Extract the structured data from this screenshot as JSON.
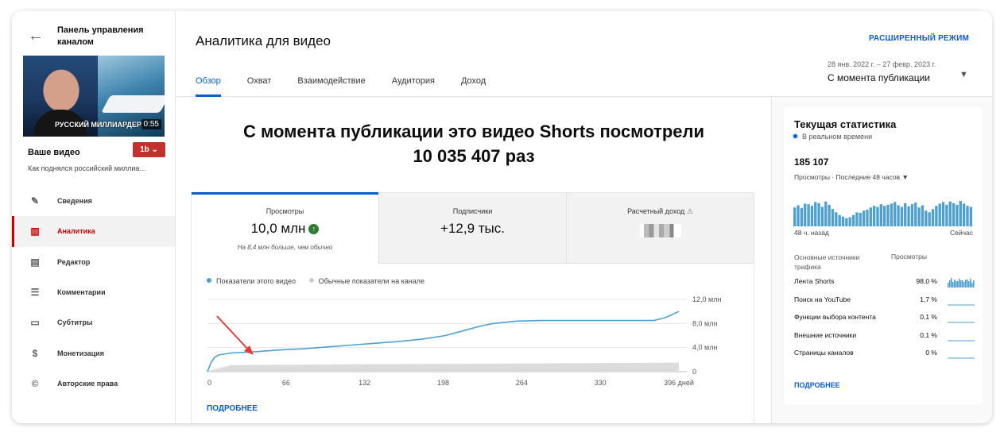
{
  "sidebar": {
    "title": "Панель управления каналом",
    "thumbnail_overlay": "РУССКИЙ МИЛЛИАРДЕР",
    "duration": "0:55",
    "your_video": "Ваше видео",
    "video_title": "Как поднялся российский миллиа…",
    "items": [
      {
        "label": "Сведения",
        "icon": "pencil-icon"
      },
      {
        "label": "Аналитика",
        "icon": "analytics-icon",
        "active": true
      },
      {
        "label": "Редактор",
        "icon": "clapperboard-icon"
      },
      {
        "label": "Комментарии",
        "icon": "comment-icon"
      },
      {
        "label": "Субтитры",
        "icon": "subtitles-icon"
      },
      {
        "label": "Монетизация",
        "icon": "dollar-icon"
      },
      {
        "label": "Авторские права",
        "icon": "copyright-icon"
      }
    ]
  },
  "header": {
    "title": "Аналитика для видео",
    "advanced_mode": "РАСШИРЕННЫЙ РЕЖИМ",
    "date_range": "28 янв. 2022 г. – 27 февр. 2023 г.",
    "date_value": "С момента публикации",
    "tabs": [
      "Обзор",
      "Охват",
      "Взаимодействие",
      "Аудитория",
      "Доход"
    ]
  },
  "overview": {
    "headline_line1": "С момента публикации это видео Shorts посмотрели",
    "headline_line2": "10 035 407 раз",
    "metrics": [
      {
        "label": "Просмотры",
        "value": "10,0 млн",
        "note": "На 8,4 млн больше, чем обычно"
      },
      {
        "label": "Подписчики",
        "value": "+12,9 тыс."
      },
      {
        "label": "Расчетный доход",
        "value": ""
      }
    ],
    "legend": [
      "Показатели этого видео",
      "Обычные показатели на канале"
    ],
    "more": "ПОДРОБНЕЕ"
  },
  "chart_data": {
    "type": "line",
    "x_ticks": [
      "0",
      "66",
      "132",
      "198",
      "264",
      "330",
      "396 дней"
    ],
    "y_ticks": [
      "12,0 млн",
      "8,0 млн",
      "4,0 млн",
      "0"
    ],
    "ylim": [
      0,
      12
    ],
    "xlim": [
      0,
      396
    ],
    "series": [
      {
        "name": "Показатели этого видео",
        "color": "#4da0cf",
        "x": [
          0,
          3,
          6,
          10,
          20,
          40,
          60,
          80,
          100,
          120,
          140,
          160,
          180,
          200,
          215,
          230,
          240,
          250,
          260,
          280,
          300,
          330,
          350,
          375,
          385,
          396
        ],
        "y": [
          0,
          1.5,
          2.4,
          2.8,
          3.1,
          3.3,
          3.6,
          3.8,
          4.1,
          4.4,
          4.7,
          5.0,
          5.4,
          6.0,
          6.8,
          7.6,
          8.0,
          8.2,
          8.4,
          8.5,
          8.5,
          8.5,
          8.5,
          8.5,
          9.0,
          10.0
        ]
      },
      {
        "name": "Обычные показатели на канале",
        "color": "#dcdcdc",
        "x": [
          0,
          20,
          100,
          200,
          300,
          396
        ],
        "y": [
          0.1,
          1.1,
          1.2,
          1.3,
          1.4,
          1.5
        ]
      }
    ]
  },
  "realtime": {
    "title": "Текущая статистика",
    "live": "В реальном времени",
    "number": "185 107",
    "sub": "Просмотры · Последние 48 часов",
    "from": "48 ч. назад",
    "to": "Сейчас",
    "bars": [
      0.7,
      0.78,
      0.68,
      0.84,
      0.82,
      0.76,
      0.9,
      0.86,
      0.72,
      0.92,
      0.8,
      0.64,
      0.52,
      0.42,
      0.36,
      0.3,
      0.34,
      0.42,
      0.52,
      0.5,
      0.58,
      0.62,
      0.7,
      0.76,
      0.72,
      0.82,
      0.76,
      0.8,
      0.84,
      0.9,
      0.78,
      0.72,
      0.86,
      0.74,
      0.82,
      0.88,
      0.7,
      0.78,
      0.58,
      0.52,
      0.64,
      0.76,
      0.84,
      0.9,
      0.8,
      0.92,
      0.86,
      0.8,
      0.94,
      0.84,
      0.76,
      0.72
    ],
    "col_source": "Основные источники трафика",
    "col_views": "Просмотры",
    "sources": [
      {
        "name": "Лента Shorts",
        "pct": "98,0 %"
      },
      {
        "name": "Поиск на YouTube",
        "pct": "1,7 %"
      },
      {
        "name": "Функции выбора контента",
        "pct": "0,1 %"
      },
      {
        "name": "Внешние источники",
        "pct": "0,1 %"
      },
      {
        "name": "Страницы каналов",
        "pct": "0 %"
      }
    ],
    "more": "ПОДРОБНЕЕ"
  }
}
